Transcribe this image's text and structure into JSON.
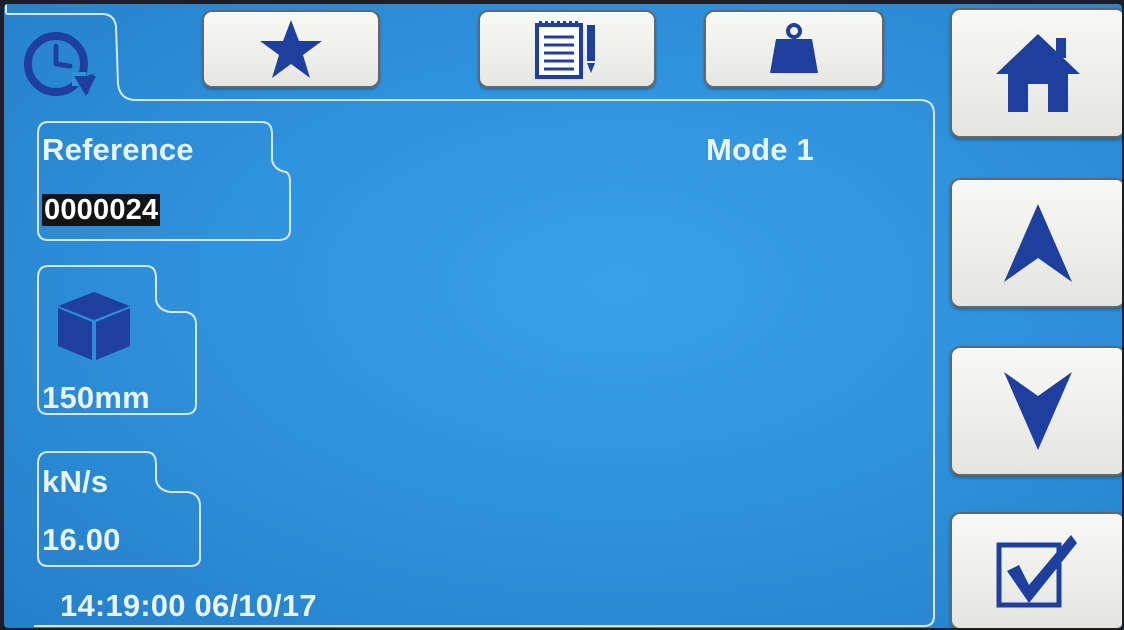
{
  "colors": {
    "screen_bg": "#2f92dd",
    "icon_blue": "#1f3f9f",
    "text_light": "#e9f3fb",
    "button_bg": "#f2f2ee"
  },
  "tabs": [
    {
      "icon": "clock-refresh-icon",
      "active": true
    },
    {
      "icon": "star-icon",
      "active": false
    },
    {
      "icon": "notepad-icon",
      "active": false
    },
    {
      "icon": "weight-icon",
      "active": false
    }
  ],
  "main": {
    "mode_label": "Mode 1",
    "reference": {
      "label": "Reference",
      "value": "0000024"
    },
    "specimen": {
      "icon": "cube-icon",
      "value": "150mm"
    },
    "rate": {
      "label": "kN/s",
      "value": "16.00"
    },
    "datetime": "14:19:00 06/10/17"
  },
  "side_buttons": [
    {
      "icon": "home-icon"
    },
    {
      "icon": "arrow-up-icon"
    },
    {
      "icon": "arrow-down-icon"
    },
    {
      "icon": "checkbox-checked-icon"
    }
  ]
}
